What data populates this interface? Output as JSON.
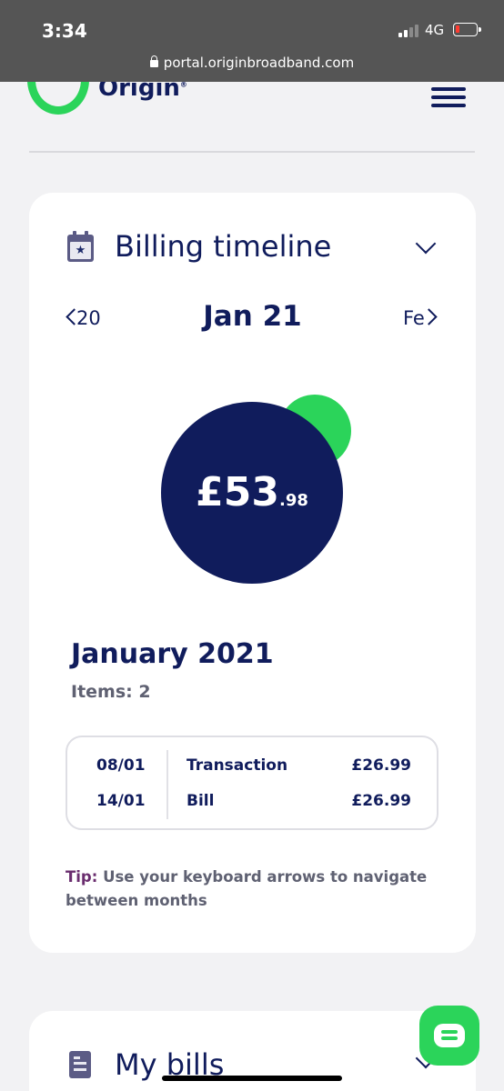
{
  "status_bar": {
    "time": "3:34",
    "network": "4G",
    "url": "portal.originbroadband.com"
  },
  "header": {
    "logo_text": "Origin",
    "logo_mark": "®"
  },
  "billing_card": {
    "title": "Billing timeline",
    "nav": {
      "prev_label": "20",
      "current_label": "Jan 21",
      "next_label": "Fe"
    },
    "amount": {
      "main": "£53",
      "pence": ".98"
    },
    "period_title": "January 2021",
    "items_count": "Items: 2",
    "transactions": [
      {
        "date": "08/01",
        "type": "Transaction",
        "amount": "£26.99"
      },
      {
        "date": "14/01",
        "type": "Bill",
        "amount": "£26.99"
      }
    ],
    "tip": {
      "label": "Tip:",
      "text": " Use your keyboard arrows to navigate between months"
    }
  },
  "bills_card": {
    "title": "My bills"
  },
  "colors": {
    "brand_green": "#2bd45a",
    "navy": "#101c5c",
    "tip_purple": "#6a2d6e"
  },
  "icons": [
    "lock-icon",
    "calendar-star-icon",
    "chevron-down-icon",
    "chevron-left-icon",
    "chevron-right-icon",
    "document-icon",
    "chat-icon",
    "menu-icon"
  ]
}
